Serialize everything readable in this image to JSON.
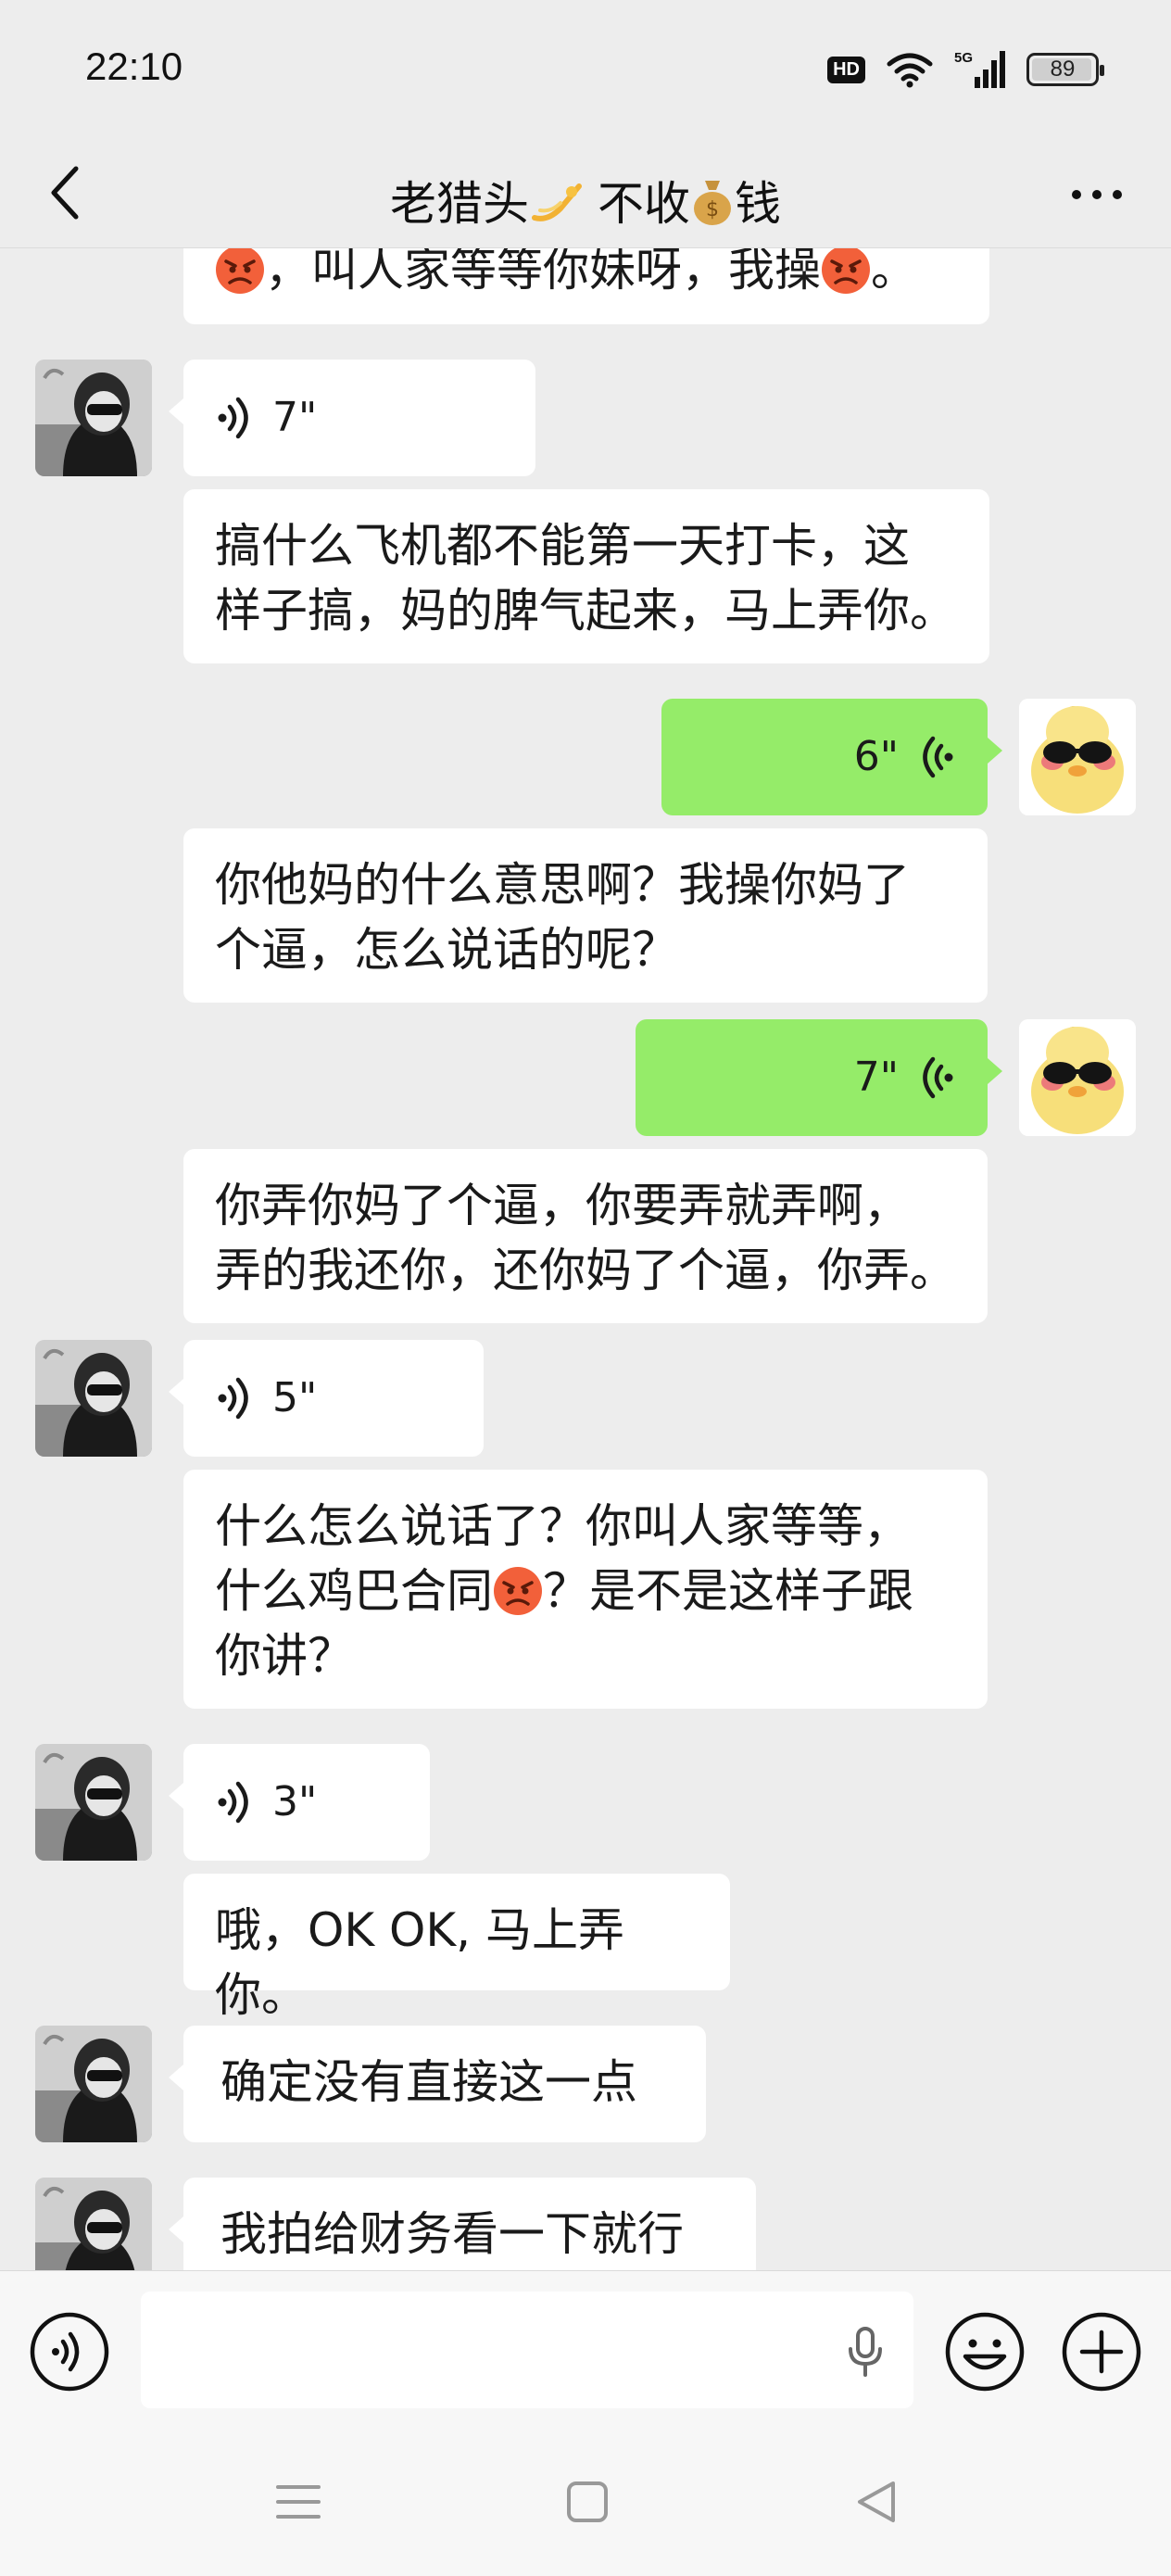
{
  "status": {
    "time": "22:10",
    "hd": "HD",
    "network": "5G",
    "battery": "89",
    "battery_level": 0.89
  },
  "header": {
    "back_icon": "chevron-left-icon",
    "title_part1": "老猎头",
    "title_part2": " 不收",
    "title_part3": "钱",
    "title_emoji_1": "dizzy-emoji",
    "title_emoji_2": "money-bag-emoji",
    "more_icon": "more-dots-icon"
  },
  "messages": [
    {
      "id": "m0",
      "sender": "peer",
      "type": "text",
      "text_a": "，叫人家等等你妹呀，我操",
      "text_b": "。"
    },
    {
      "id": "m1",
      "sender": "peer",
      "type": "voice",
      "duration": "7\""
    },
    {
      "id": "m2",
      "sender": "peer",
      "type": "text",
      "line1": "搞什么飞机都不能第一天打卡，这",
      "line2": "样子搞，妈的脾气起来，马上弄你。"
    },
    {
      "id": "m3",
      "sender": "self",
      "type": "voice",
      "duration": "6\""
    },
    {
      "id": "m4",
      "sender": "self",
      "type": "text",
      "line1": "你他妈的什么意思啊？我操你妈了",
      "line2": "个逼，怎么说话的呢？"
    },
    {
      "id": "m5",
      "sender": "self",
      "type": "voice",
      "duration": "7\""
    },
    {
      "id": "m6",
      "sender": "self",
      "type": "text",
      "line1": "你弄你妈了个逼，你要弄就弄啊，",
      "line2": "弄的我还你，还你妈了个逼，你弄。"
    },
    {
      "id": "m7",
      "sender": "peer",
      "type": "voice",
      "duration": "5\""
    },
    {
      "id": "m8",
      "sender": "peer",
      "type": "text",
      "line1": "什么怎么说话了？你叫人家等等，",
      "line2a": "什么鸡巴合同",
      "line2b": "？是不是这样子跟",
      "line3": "你讲？"
    },
    {
      "id": "m9",
      "sender": "peer",
      "type": "voice",
      "duration": "3\""
    },
    {
      "id": "m10",
      "sender": "peer",
      "type": "text",
      "text": "哦，OK OK, 马上弄你。"
    },
    {
      "id": "m11",
      "sender": "peer",
      "type": "text",
      "text": "确定没有直接这一点"
    },
    {
      "id": "m12",
      "sender": "peer",
      "type": "text",
      "text": "我拍给财务看一下就行"
    }
  ],
  "input_bar": {
    "voice_toggle_icon": "voice-mode-icon",
    "input_value": "",
    "mic_icon": "microphone-icon",
    "emoji_icon": "smiley-icon",
    "plus_icon": "plus-circle-icon"
  },
  "nav_bar": {
    "menu_icon": "menu-icon",
    "home_icon": "home-square-icon",
    "back_icon": "back-triangle-icon"
  },
  "colors": {
    "background": "#ededed",
    "bubble_in": "#ffffff",
    "bubble_out": "#95ec69",
    "angry_emoji": "#f2603a"
  }
}
